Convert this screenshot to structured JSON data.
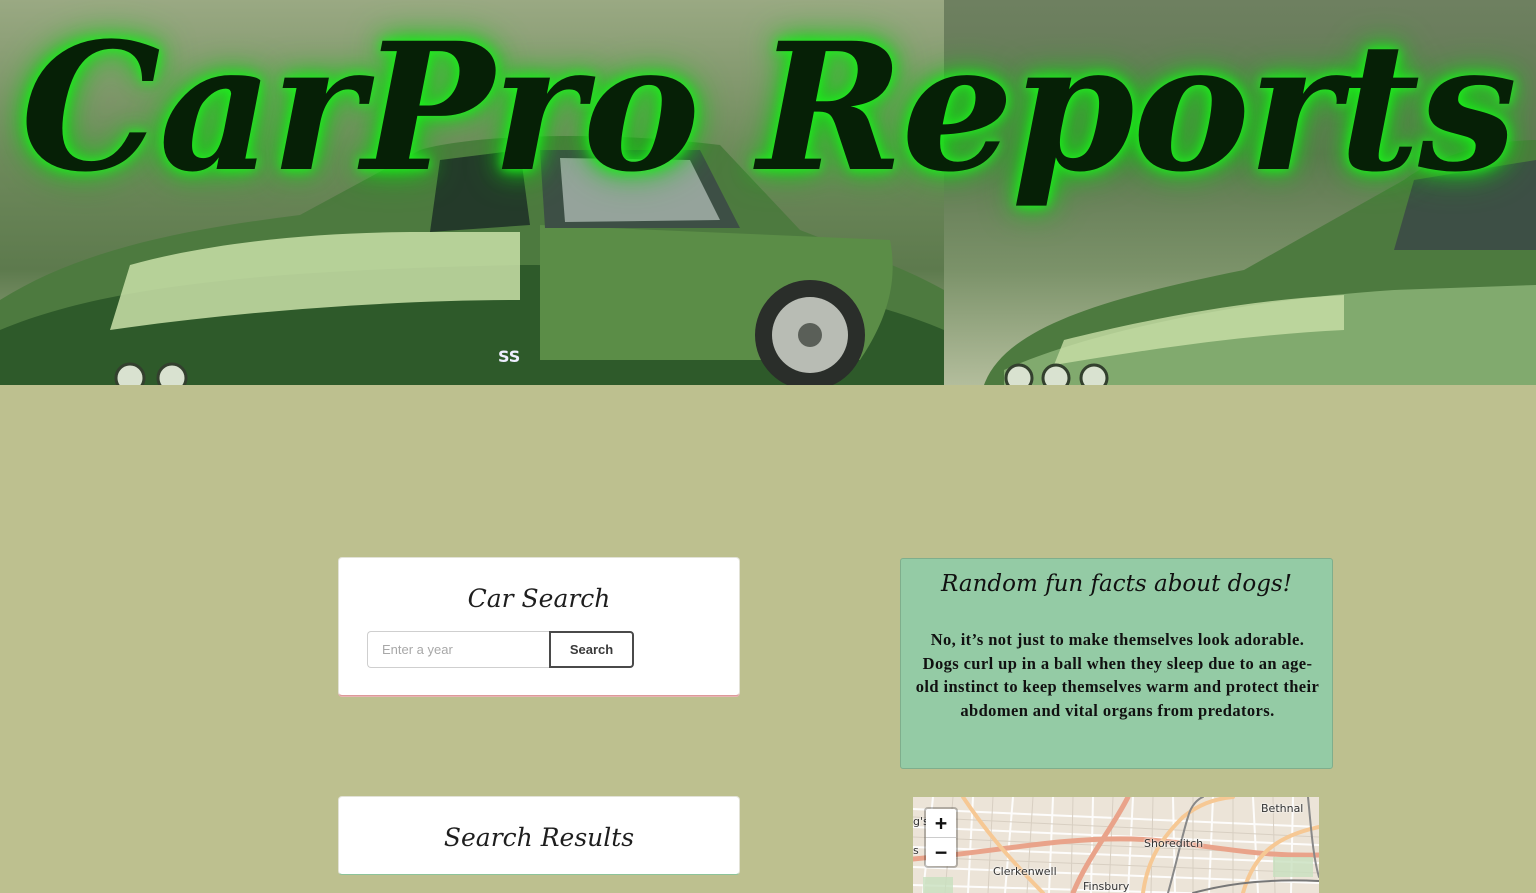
{
  "hero": {
    "title": "CarPro Reports",
    "glow_color": "#1ef51e",
    "text_color": "#062006"
  },
  "car_search": {
    "title": "Car Search",
    "year_input": {
      "placeholder": "Enter a year",
      "value": ""
    },
    "search_label": "Search"
  },
  "search_results": {
    "title": "Search Results"
  },
  "dog_facts": {
    "title": "Random fun facts about dogs!",
    "fact": "No, it’s not just to make themselves look adorable. Dogs curl up in a ball when they sleep due to an age-old instinct to keep themselves warm and protect their abdomen and vital organs from predators."
  },
  "map": {
    "zoom_in": "+",
    "zoom_out": "−",
    "labels": [
      "Bethnal",
      "Shoreditch",
      "Clerkenwell",
      "Finsbury",
      "g's",
      "s"
    ]
  },
  "colors": {
    "page_background": "#bdc08f",
    "facts_background": "#94cba5",
    "card_background": "#ffffff"
  }
}
